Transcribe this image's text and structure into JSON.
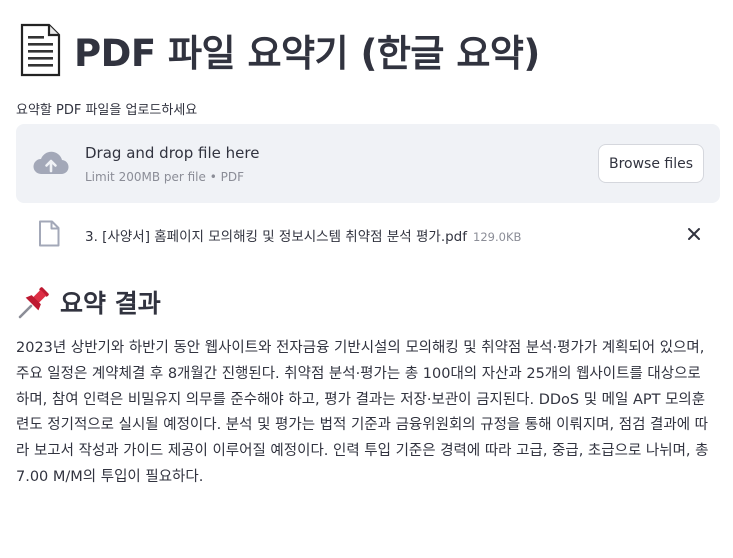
{
  "title": {
    "icon": "page-facing-up-icon",
    "text": "PDF 파일 요약기 (한글 요약)"
  },
  "uploader": {
    "label": "요약할 PDF 파일을 업로드하세요",
    "dropzone": {
      "icon": "cloud-upload-icon",
      "title": "Drag and drop file here",
      "limit": "Limit 200MB per file • PDF",
      "browse_label": "Browse files"
    },
    "file": {
      "icon": "file-icon",
      "name": "3. [사양서] 홈페이지 모의해킹 및 정보시스템 취약점 분석 평가.pdf",
      "size": "129.0KB",
      "remove_icon": "close-icon"
    }
  },
  "result": {
    "icon": "pushpin-icon",
    "heading": "요약 결과",
    "summary": "2023년 상반기와 하반기 동안 웹사이트와 전자금융 기반시설의 모의해킹 및 취약점 분석·평가가 계획되어 있으며, 주요 일정은 계약체결 후 8개월간 진행된다. 취약점 분석·평가는 총 100대의 자산과 25개의 웹사이트를 대상으로 하며, 참여 인력은 비밀유지 의무를 준수해야 하고, 평가 결과는 저장·보관이 금지된다. DDoS 및 메일 APT 모의훈련도 정기적으로 실시될 예정이다. 분석 및 평가는 법적 기준과 금융위원회의 규정을 통해 이뤄지며, 점검 결과에 따라 보고서 작성과 가이드 제공이 이루어질 예정이다. 인력 투입 기준은 경력에 따라 고급, 중급, 초급으로 나뉘며, 총 7.00 M/M의 투입이 필요하다."
  },
  "colors": {
    "text": "#31333f",
    "muted": "#8b8d97",
    "dropzone_bg": "#f0f2f6",
    "icon": "#a3a8b8",
    "pin_red": "#d62d36"
  }
}
